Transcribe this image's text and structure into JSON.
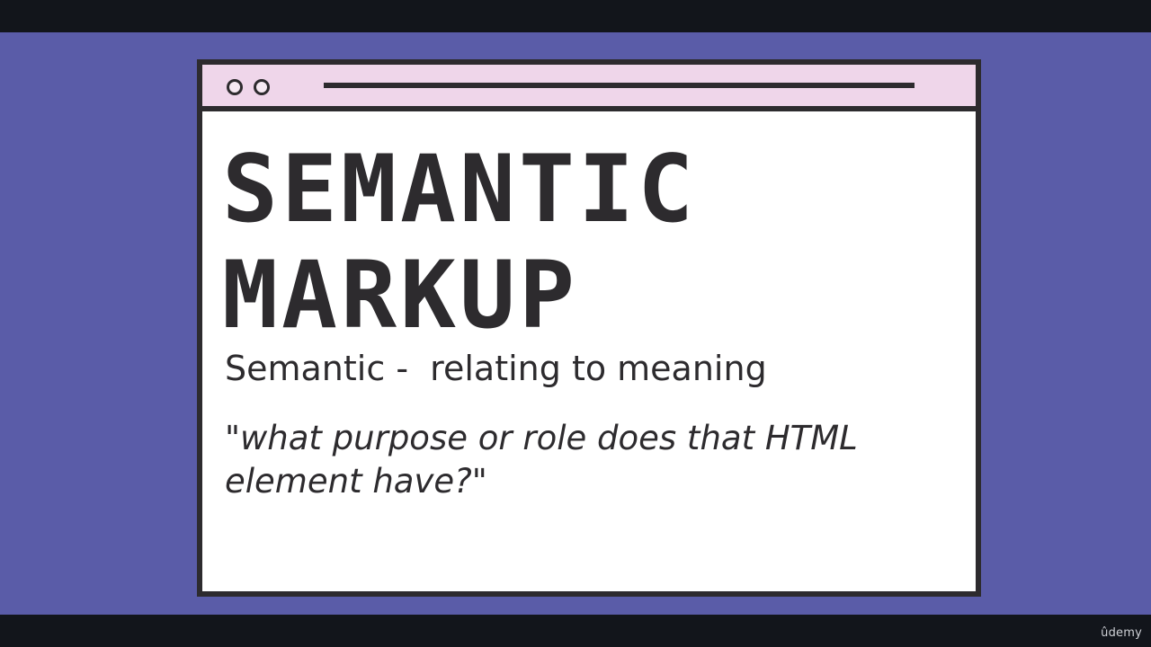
{
  "slide": {
    "title_line1": "SEMANTIC",
    "title_line2": "MARKUP",
    "definition": "Semantic -  relating to meaning",
    "quote_line1": "\"what purpose or role does that HTML",
    "quote_line2": "element have?\""
  },
  "watermark": "ûdemy",
  "colors": {
    "background": "#5a5ca8",
    "bars": "#12151b",
    "window_border": "#2d2b2e",
    "titlebar": "#efd6ea",
    "content": "#ffffff"
  },
  "icons": [
    "window-control-dot-icon",
    "window-control-dot-icon",
    "address-bar-line"
  ]
}
